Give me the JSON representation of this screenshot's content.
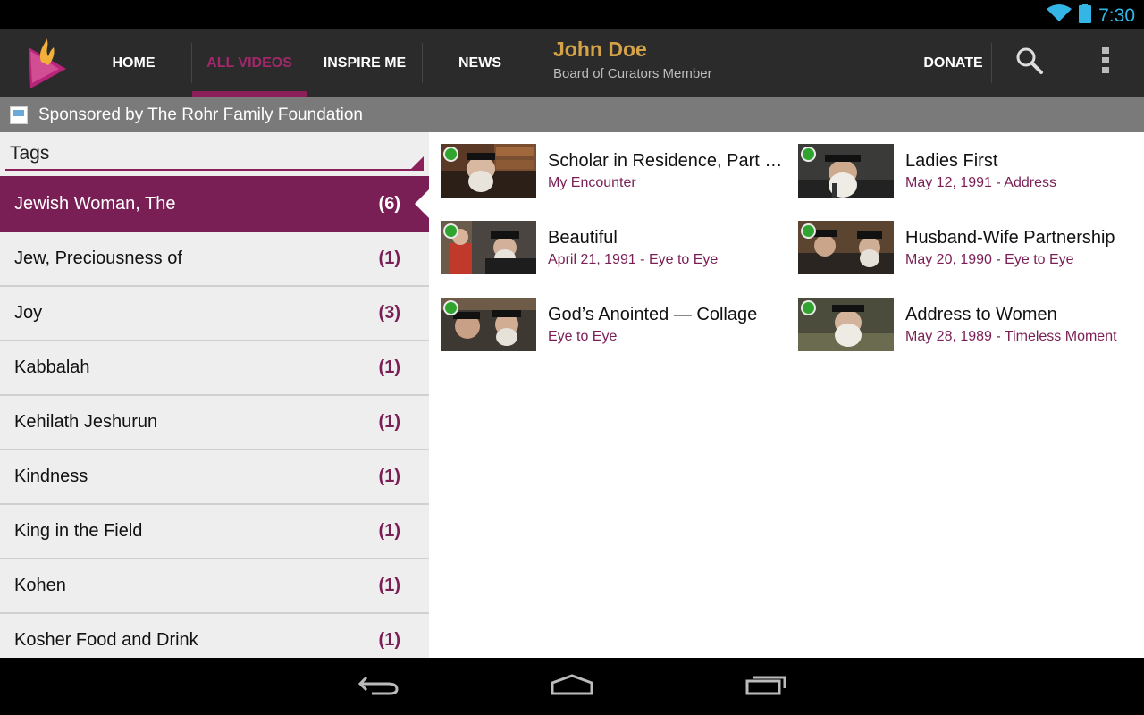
{
  "status": {
    "time": "7:30"
  },
  "tabs": [
    {
      "label": "HOME",
      "active": false
    },
    {
      "label": "ALL VIDEOS",
      "active": true
    },
    {
      "label": "INSPIRE ME",
      "active": false
    },
    {
      "label": "NEWS",
      "active": false
    }
  ],
  "user": {
    "name": "John Doe",
    "role": "Board of Curators Member"
  },
  "donate_label": "DONATE",
  "sponsor": {
    "text": "Sponsored by The Rohr Family Foundation"
  },
  "tags_label": "Tags",
  "tags": [
    {
      "name": "Jewish Woman, The",
      "count": "(6)"
    },
    {
      "name": "Jew, Preciousness of",
      "count": "(1)"
    },
    {
      "name": "Joy",
      "count": "(3)"
    },
    {
      "name": "Kabbalah",
      "count": "(1)"
    },
    {
      "name": "Kehilath Jeshurun",
      "count": "(1)"
    },
    {
      "name": "Kindness",
      "count": "(1)"
    },
    {
      "name": "King in the Field",
      "count": "(1)"
    },
    {
      "name": "Kohen",
      "count": "(1)"
    },
    {
      "name": "Kosher Food and Drink",
      "count": "(1)"
    }
  ],
  "videos": [
    {
      "title": "Scholar in Residence, Part …",
      "subtitle": "My Encounter"
    },
    {
      "title": "Ladies First",
      "subtitle": "May 12, 1991 - Address"
    },
    {
      "title": "Beautiful",
      "subtitle": "April 21, 1991 - Eye to Eye"
    },
    {
      "title": "Husband-Wife Partnership",
      "subtitle": "May 20, 1990 - Eye to Eye"
    },
    {
      "title": "God’s Anointed — Collage",
      "subtitle": "Eye to Eye"
    },
    {
      "title": "Address to Women",
      "subtitle": "May 28, 1989 - Timeless Moment"
    }
  ],
  "colors": {
    "accent": "#7a1f55",
    "highlight_tab": "#a2286b",
    "user_name": "#d4a348",
    "status_icons": "#33b5e5"
  }
}
